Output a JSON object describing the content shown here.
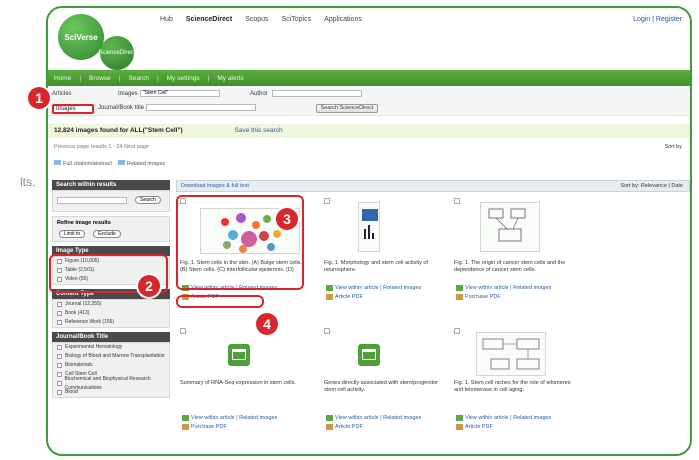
{
  "peek_text": "lts.",
  "brand": {
    "logo": "SciVerse",
    "logo_sub": "ScienceDirect"
  },
  "top_nav": [
    "Hub",
    "ScienceDirect",
    "Scopus",
    "SciTopics",
    "Applications"
  ],
  "top_links": "Login | Register",
  "nav_bar": [
    "Home",
    "Browse",
    "Search",
    "My settings",
    "My alerts"
  ],
  "search": {
    "articles_label": "Articles",
    "images_label": "Images",
    "images_query": "\"Stem Cell\"",
    "author_label": "Author",
    "journal_label": "Journal/Book title",
    "button": "Search ScienceDirect"
  },
  "results": {
    "summary": "12,824 images found for ALL(\"Stem Cell\")",
    "save": "Save this search"
  },
  "pager": "Previous page results 1 - 24 Next page",
  "sort": "Sort by",
  "download_bar": [
    "Full citation/abstract",
    "Related images"
  ],
  "sidebar": {
    "search_within": "Search within results",
    "search_btn": "Search",
    "refine_title": "Refine image results",
    "limit_btn": "Limit to",
    "exclude_btn": "Exclude",
    "image_type": {
      "title": "Image Type",
      "items": [
        "Figure (10,005)",
        "Table (2,501)",
        "Video (55)"
      ]
    },
    "content_type": {
      "title": "Content Type",
      "items": [
        "Journal (12,255)",
        "Book (413)",
        "Reference Work (156)"
      ]
    },
    "journal_title": {
      "title": "Journal/Book Title",
      "items": [
        "Experimental Hematology",
        "Biology of Blood and Marrow Transplantation",
        "Biomaterials",
        "Cell Stem Cell",
        "Biochemical and Biophysical Research Communications",
        "Blood"
      ]
    }
  },
  "pane": {
    "left_link": "Download images & full text",
    "right": "Sort by: Relevance | Date"
  },
  "cells": [
    {
      "cap": "Fig. 1. Stem cells in the skin. (A) Bulge stem cells. (B) Stem cells. (C) Interfollicular epidermis. (D)",
      "l1": "View within article | Related images",
      "l2": "Article PDF"
    },
    {
      "cap": "Fig. 1. Morphology and stem cell activity of neurosphere.",
      "l1": "View within article | Related images",
      "l2": "Article PDF"
    },
    {
      "cap": "Fig. 1. The origin of cancer stem cells and the dependence of cancer stem cells.",
      "l1": "View within article | Related images",
      "l2": "Purchase PDF"
    },
    {
      "cap": "Summary of RNA-Seq expression in stem cells.",
      "l1": "View within article | Related images",
      "l2": "Purchase PDF"
    },
    {
      "cap": "Genes directly associated with stem/progenitor stem cell activity.",
      "l1": "View within article | Related images",
      "l2": "Article PDF"
    },
    {
      "cap": "Fig. 1. Stem cell niches for the role of telomeres and telomerase in cell aging.",
      "l1": "View within article | Related images",
      "l2": "Article PDF"
    }
  ],
  "callouts": [
    "1",
    "2",
    "3",
    "4"
  ],
  "colors": {
    "frame": "#3f9b3a",
    "accent": "#d9262c",
    "nav": "#4f9e3a"
  }
}
